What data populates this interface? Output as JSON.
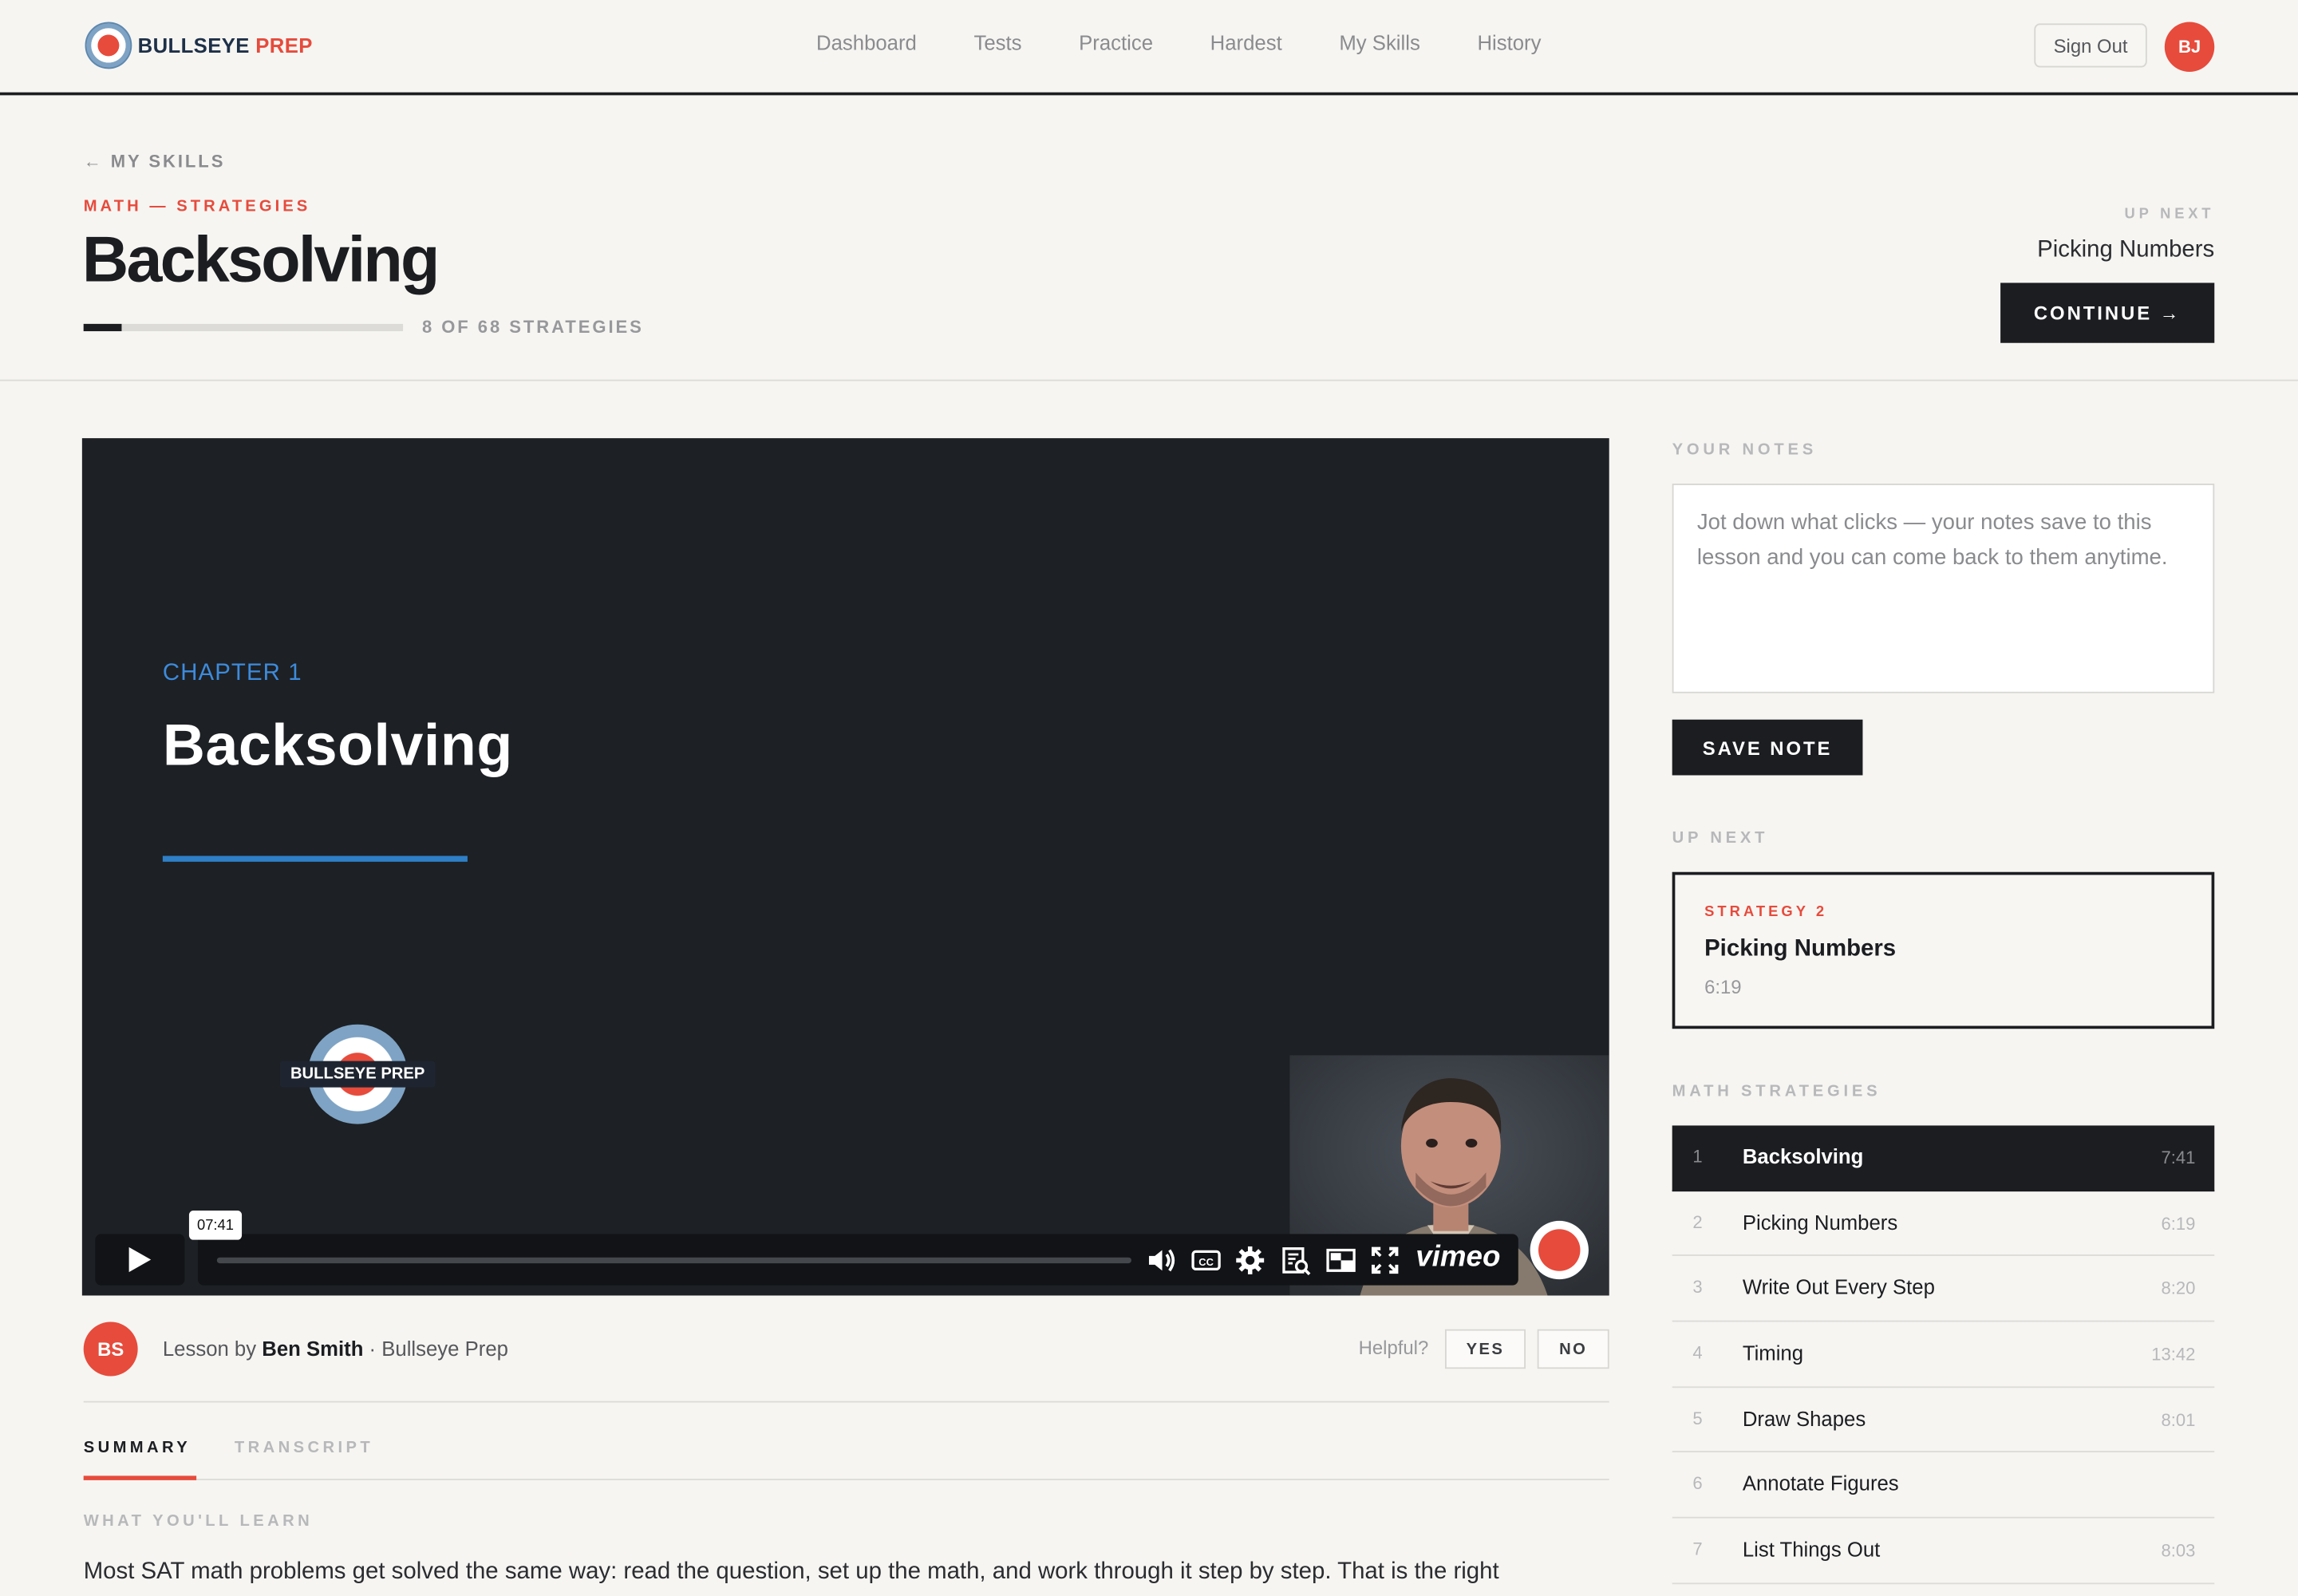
{
  "brand": {
    "name_part1": "BULLSEYE",
    "name_part2": "PREP"
  },
  "nav": {
    "items": [
      {
        "label": "Dashboard"
      },
      {
        "label": "Tests"
      },
      {
        "label": "Practice"
      },
      {
        "label": "Hardest"
      },
      {
        "label": "My Skills"
      },
      {
        "label": "History"
      }
    ],
    "sign_out_label": "Sign Out",
    "user_initials": "BJ"
  },
  "hero": {
    "back_label": "← MY SKILLS",
    "breadcrumb": "MATH — STRATEGIES",
    "title": "Backsolving",
    "progress_fraction": 0.12,
    "progress_text": "8 OF 68 STRATEGIES",
    "up_next_label": "UP NEXT",
    "up_next_title": "Picking Numbers",
    "continue_label": "CONTINUE →"
  },
  "video": {
    "chapter_label": "CHAPTER 1",
    "chapter_title": "Backsolving",
    "logo_text": "BULLSEYE PREP",
    "time_tooltip": "07:41",
    "player_brand": "vimeo",
    "icons": [
      "play-icon",
      "volume-icon",
      "captions-icon",
      "settings-icon",
      "transcript-icon",
      "pip-icon",
      "fullscreen-icon"
    ]
  },
  "byline": {
    "author_initials": "BS",
    "prefix": "Lesson by",
    "author": "Ben Smith",
    "suffix": "· Bullseye Prep",
    "helpful_label": "Helpful?",
    "yes_label": "YES",
    "no_label": "NO"
  },
  "tabs": [
    {
      "label": "SUMMARY",
      "active": true
    },
    {
      "label": "TRANSCRIPT",
      "active": false
    }
  ],
  "summary": {
    "heading": "WHAT YOU'LL LEARN",
    "text": "Most SAT math problems get solved the same way: read the question, set up the math, and work through it step by step. That is the right"
  },
  "notes": {
    "label": "YOUR NOTES",
    "placeholder": "Jot down what clicks — your notes save to this lesson and you can come back to them anytime.",
    "value": "",
    "save_label": "SAVE NOTE"
  },
  "up_next_card": {
    "label": "UP NEXT",
    "strategy_label": "STRATEGY 2",
    "title": "Picking Numbers",
    "duration": "6:19"
  },
  "strategies": {
    "label": "MATH STRATEGIES",
    "items": [
      {
        "num": "1",
        "title": "Backsolving",
        "duration": "7:41",
        "active": true
      },
      {
        "num": "2",
        "title": "Picking Numbers",
        "duration": "6:19",
        "active": false
      },
      {
        "num": "3",
        "title": "Write Out Every Step",
        "duration": "8:20",
        "active": false
      },
      {
        "num": "4",
        "title": "Timing",
        "duration": "13:42",
        "active": false
      },
      {
        "num": "5",
        "title": "Draw Shapes",
        "duration": "8:01",
        "active": false
      },
      {
        "num": "6",
        "title": "Annotate Figures",
        "duration": "",
        "active": false
      },
      {
        "num": "7",
        "title": "List Things Out",
        "duration": "8:03",
        "active": false
      }
    ]
  },
  "colors": {
    "accent": "#e64b3c",
    "ink": "#1b1d21",
    "chapter_blue": "#3d8bdc",
    "background": "#f6f5f2"
  }
}
